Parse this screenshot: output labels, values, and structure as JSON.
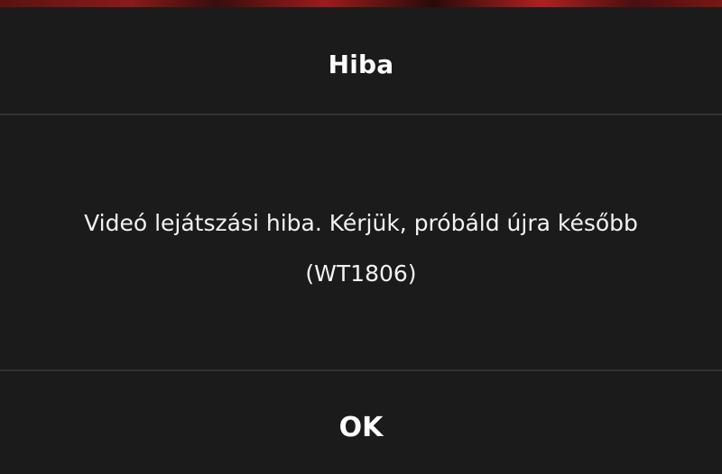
{
  "dialog": {
    "title": "Hiba",
    "message_line1": "Videó lejátszási hiba. Kérjük, próbáld újra később",
    "message_line2": "(WT1806)",
    "ok_label": "OK"
  },
  "colors": {
    "background": "#1b1b1b",
    "divider": "#333333",
    "text": "#ffffff"
  }
}
